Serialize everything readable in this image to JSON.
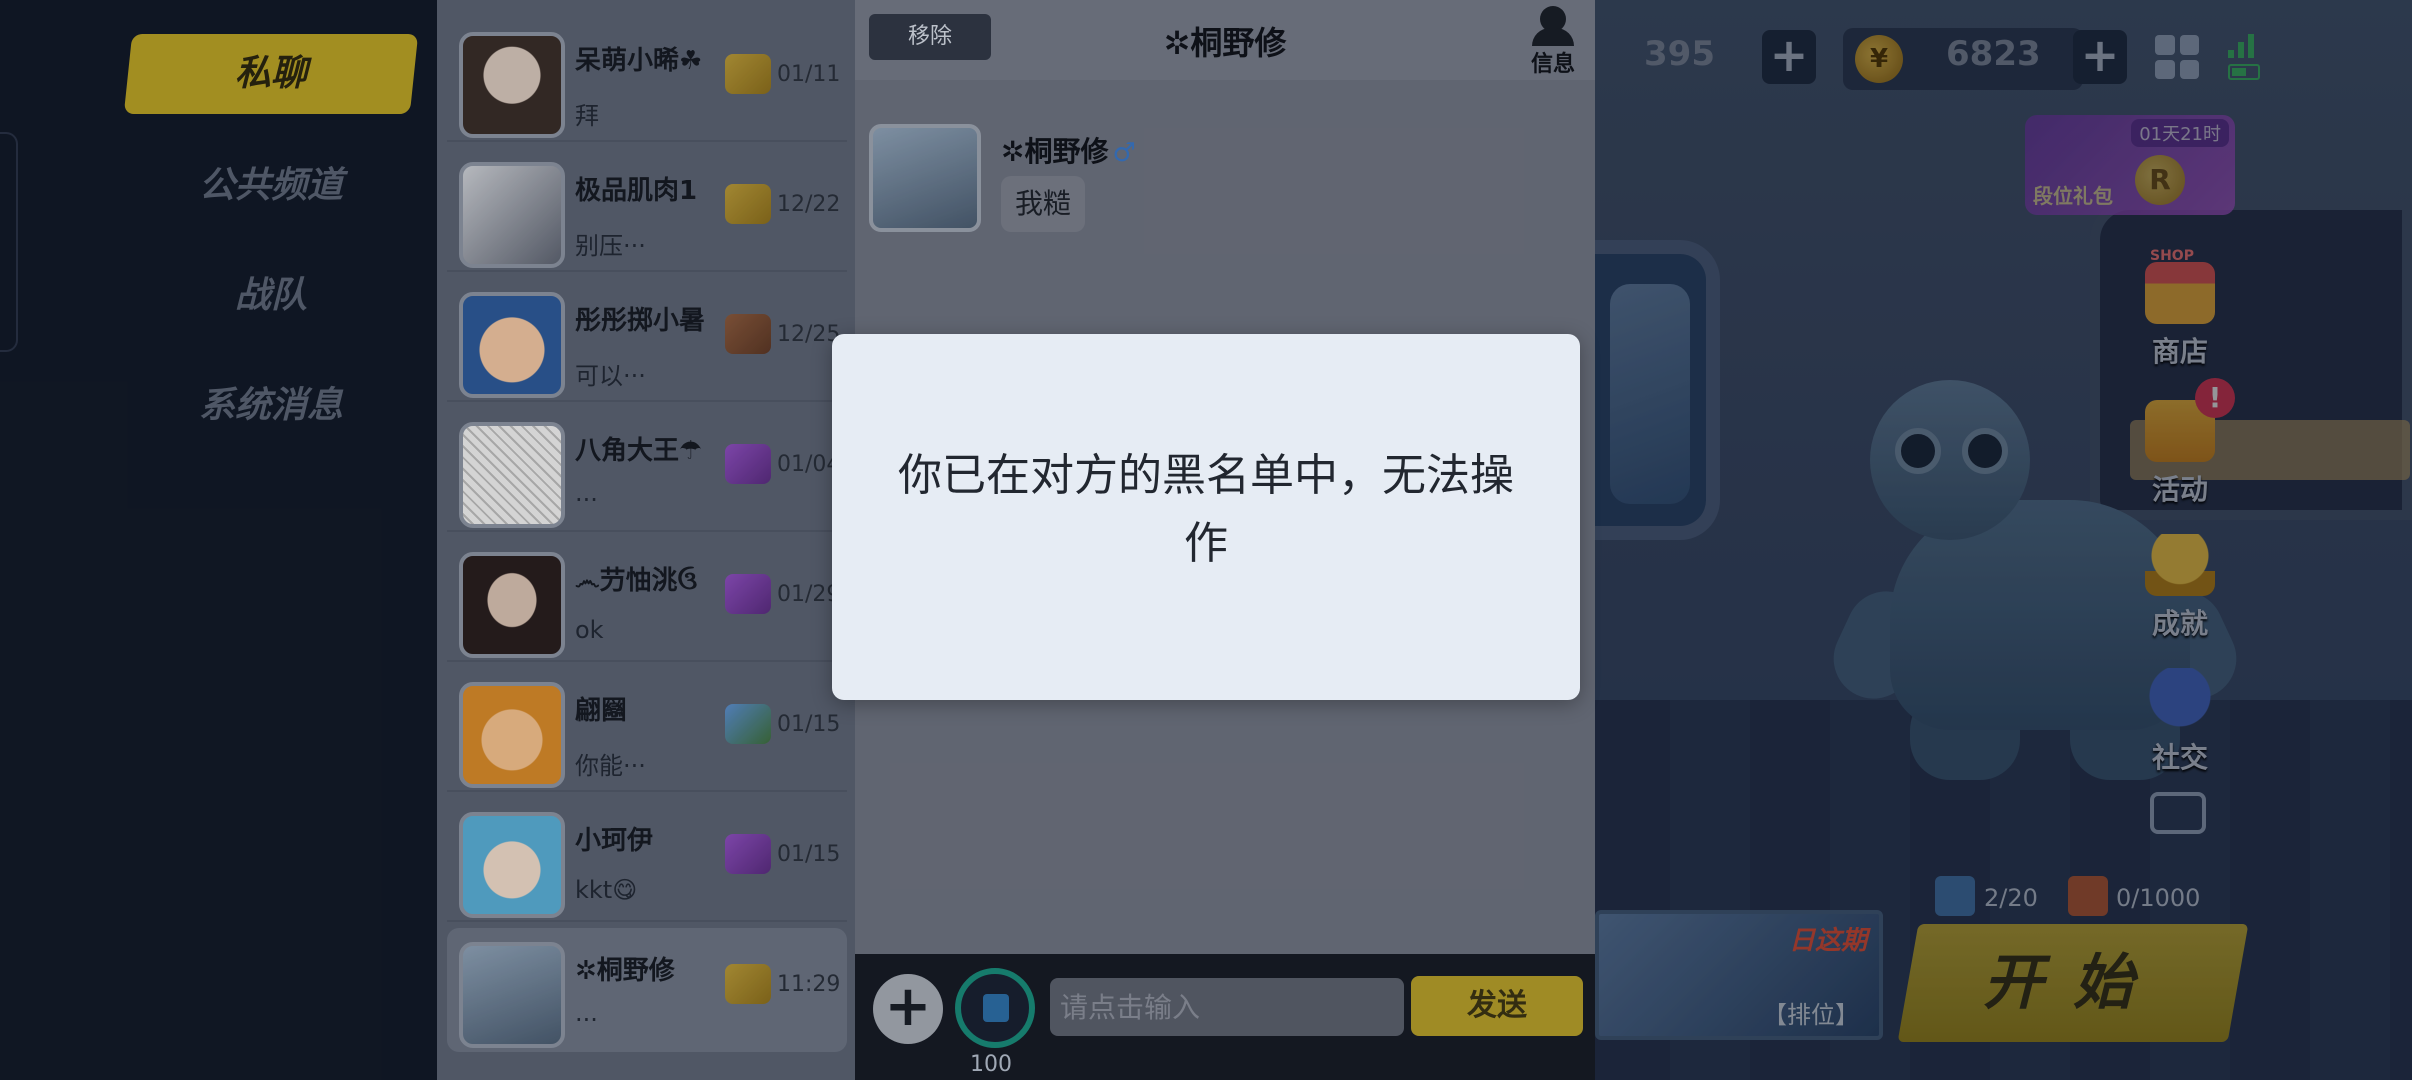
{
  "sidebar": {
    "tabs": [
      {
        "label": "私聊",
        "active": true
      },
      {
        "label": "公共频道",
        "active": false
      },
      {
        "label": "战队",
        "active": false
      },
      {
        "label": "系统消息",
        "active": false
      }
    ]
  },
  "conversations": [
    {
      "name": "呆萌小晞☘",
      "preview": "拜",
      "date": "01/11",
      "rank": "gold"
    },
    {
      "name": "极品肌肉1",
      "preview": "别压···",
      "date": "12/22",
      "rank": "gold"
    },
    {
      "name": "彤彤掷小暑",
      "preview": "可以···",
      "date": "12/25",
      "rank": "brown"
    },
    {
      "name": "八角大王☂",
      "preview": "···",
      "date": "01/04",
      "rank": "purple"
    },
    {
      "name": "෴芀怞洮ઉ",
      "preview": "ok",
      "date": "01/29",
      "rank": "purple"
    },
    {
      "name": "翩圝",
      "preview": "你能···",
      "date": "01/15",
      "rank": "blue"
    },
    {
      "name": "小珂伊",
      "preview": "kkt😋",
      "date": "01/15",
      "rank": "purple"
    },
    {
      "name": "✲桐野修",
      "preview": "···",
      "date": "11:29",
      "rank": "gold",
      "active": true
    }
  ],
  "chat": {
    "remove_label": "移除",
    "title": "✲桐野修",
    "info_label": "信息",
    "messages": [
      {
        "sender": "✲桐野修",
        "gender": "♂",
        "text": "我糙"
      }
    ],
    "input_placeholder": "请点击输入",
    "send_label": "发送",
    "voice_value": "100"
  },
  "hud": {
    "diamonds": "395",
    "coins": "6823",
    "coin_symbol": "¥",
    "rank_gift": {
      "timer": "01天21时",
      "label": "段位礼包",
      "coin_symbol": "R"
    }
  },
  "side_menu": {
    "shop_tag": "SHOP",
    "items": [
      {
        "label": "商店",
        "icon": "shop-icon"
      },
      {
        "label": "活动",
        "icon": "event-icon",
        "badge": "!"
      },
      {
        "label": "成就",
        "icon": "trophy-icon"
      },
      {
        "label": "社交",
        "icon": "social-icon"
      }
    ]
  },
  "counters": {
    "cards": "2/20",
    "tickets": "0/1000"
  },
  "banner": {
    "tag": "日这期",
    "rank_label": "【排位】"
  },
  "start_label": "开始",
  "modal": {
    "message": "你已在对方的黑名单中，无法操作"
  },
  "colors": {
    "accent": "#b9a226",
    "send": "#b59f2b",
    "modal_bg": "#e6ecf4"
  }
}
